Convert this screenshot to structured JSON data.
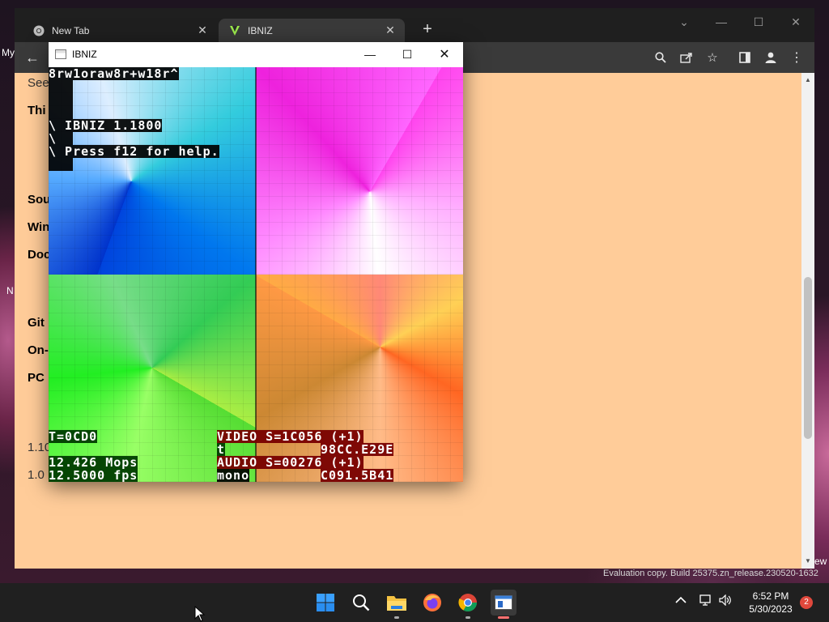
{
  "desktop": {
    "left_labels": [
      "My",
      "N"
    ],
    "right_label": "ew",
    "evaluation_text": "Evaluation copy. Build 25375.zn_release.230520-1632"
  },
  "chrome": {
    "tabs": [
      {
        "label": "New Tab",
        "icon": "chrome-icon",
        "active": false
      },
      {
        "label": "IBNIZ",
        "icon": "ibniz-logo-icon",
        "active": true
      }
    ],
    "new_tab": "+",
    "toolbar_icons": [
      "back-arrow-icon",
      "search-icon",
      "share-icon",
      "star-icon",
      "sidebar-icon",
      "profile-icon",
      "menu-icon"
    ],
    "page_lines": [
      {
        "text": "See",
        "bold": false
      },
      {
        "text": "Thi",
        "bold": true
      },
      {
        "text": "Sou",
        "bold": true
      },
      {
        "text": "Win",
        "bold": true
      },
      {
        "text": "Doc",
        "bold": true
      },
      {
        "text": "Git",
        "bold": true
      },
      {
        "text": "On-",
        "bold": true
      },
      {
        "text": "PC",
        "bold": true
      },
      {
        "text": "1.10",
        "bold": false
      },
      {
        "text": "1.0",
        "bold": false
      }
    ],
    "page_background": "#ffcc99"
  },
  "ibniz": {
    "title": "IBNIZ",
    "code_line": "8rw1oraw8r+w18r^",
    "banner1": "\\ IBNIZ 1.1800",
    "banner2": "\\ Press f12 for help.",
    "banner_prefix": "\\",
    "hud": {
      "time": "T=0CD0",
      "mops": "12.426 Mops",
      "fps": "12.5000 fps",
      "video": "VIDEO S=1C056 (+1)",
      "t_label": "t",
      "t_value": "98CC.E29E",
      "audio": "AUDIO S=00276 (+1)",
      "mono_label": "mono",
      "mono_value": "C091.5B41"
    }
  },
  "taskbar": {
    "apps": [
      "windows-start-icon",
      "search-icon",
      "file-explorer-icon",
      "firefox-icon",
      "chrome-icon",
      "ibniz-app-icon"
    ],
    "time": "6:52 PM",
    "date": "5/30/2023",
    "notifications": "2"
  }
}
